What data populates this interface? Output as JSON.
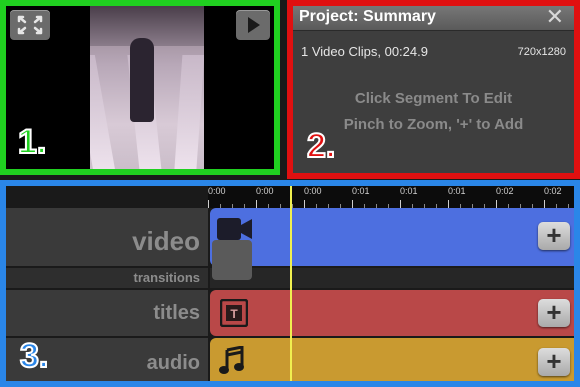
{
  "preview": {
    "panel_number": "1.",
    "fullscreen_icon": "fullscreen-icon",
    "play_icon": "play-icon",
    "accent": "#20d020"
  },
  "project": {
    "panel_number": "2.",
    "title": "Project: Summary",
    "close_label": "✕",
    "clips_info": "1 Video Clips, 00:24.9",
    "resolution": "720x1280",
    "hint_edit": "Click Segment To Edit",
    "hint_zoom": "Pinch to Zoom, '+' to Add",
    "accent": "#e01010"
  },
  "timeline": {
    "panel_number": "3.",
    "ruler_ticks": [
      "0:00",
      "0:00",
      "0:00",
      "0:01",
      "0:01",
      "0:01",
      "0:02",
      "0:02"
    ],
    "rows": {
      "video": "video",
      "transitions": "transitions",
      "titles": "titles",
      "audio": "audio"
    },
    "add_label": "+",
    "colors": {
      "video": "#4d6fe0",
      "titles": "#b94848",
      "audio": "#c99a30",
      "playhead": "#f0f050",
      "accent": "#2a86e8"
    }
  }
}
